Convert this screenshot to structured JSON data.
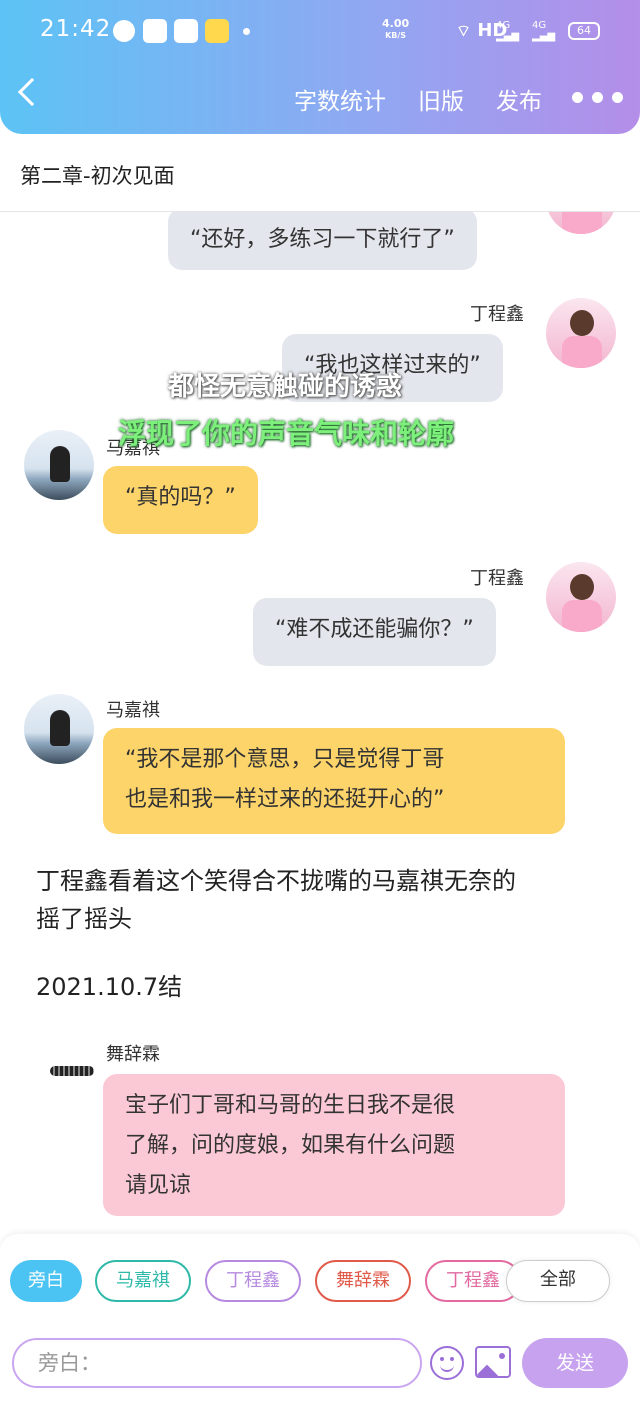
{
  "status_bar": {
    "time": "21:42",
    "net_speed": "4.00",
    "net_unit": "KB/S",
    "hd": "HD",
    "signal1": "4G",
    "signal2": "4G",
    "battery": "64"
  },
  "header": {
    "word_count": "字数统计",
    "old_version": "旧版",
    "publish": "发布"
  },
  "chapter_title": "第二章-初次见面",
  "messages": [
    {
      "text": "“还好，多练习一下就行了”"
    },
    {
      "speaker": "丁程鑫",
      "text": "“我也这样过来的”"
    },
    {
      "speaker": "马嘉祺",
      "text": "“真的吗？”"
    },
    {
      "speaker": "丁程鑫",
      "text": "“难不成还能骗你？”"
    },
    {
      "speaker": "马嘉祺",
      "line1": "“我不是那个意思，只是觉得丁哥",
      "line2": "也是和我一样过来的还挺开心的”"
    },
    {
      "narration_line1": "丁程鑫看着这个笑得合不拢嘴的马嘉祺无奈的",
      "narration_line2": "摇了摇头"
    },
    {
      "narration": "2021.10.7结"
    },
    {
      "speaker": "舞辞霖",
      "line1": "宝子们丁哥和马哥的生日我不是很",
      "line2": "了解，问的度娘，如果有什么问题",
      "line3": "请见谅"
    }
  ],
  "overlay": {
    "line1": "都怪无意触碰的诱惑",
    "line2": "浮现了你的声音气味和轮廓"
  },
  "chips": [
    "旁白",
    "马嘉祺",
    "丁程鑫",
    "舞辞霖",
    "丁程鑫",
    "全部"
  ],
  "input": {
    "placeholder": "旁白："
  },
  "send": "发送",
  "colors": {
    "accent_blue": "#4cc4f3",
    "accent_purple": "#c7a2ef",
    "chip_ma": "#2fb9a8",
    "chip_ding": "#b68ae0",
    "chip_wu": "#e05a4a",
    "chip_ding2": "#e26aa0"
  }
}
